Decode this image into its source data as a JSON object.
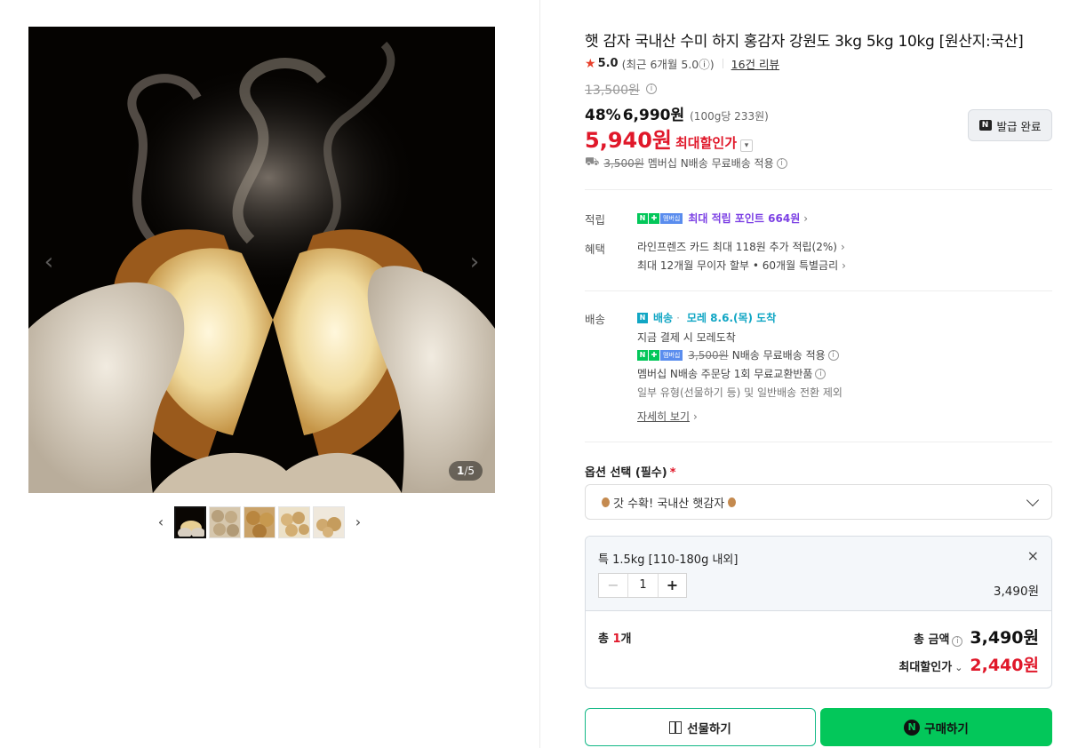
{
  "gallery": {
    "counter_current": "1",
    "counter_sep": "/",
    "counter_total": "5",
    "prev_arrow": "‹",
    "next_arrow": "›",
    "thumb_prev": "‹",
    "thumb_next": "›",
    "thumbnail_count": 5
  },
  "product": {
    "title": "햇 감자 국내산 수미 하지 홍감자 강원도 3kg 5kg 10kg [원산지:국산]",
    "star": "★",
    "rating": "5.0",
    "rating_note": "(최근 6개월 5.0ⓘ)",
    "reviews": "16건 리뷰",
    "original_price": "13,500원",
    "discount": "48%",
    "sale_price": "6,990원",
    "unit_price": "(100g당 233원)",
    "max_discount_price": "5,940원",
    "max_discount_label": "최대할인가",
    "coupon_button": "발급 완료",
    "coupon_badge": "N",
    "shipping_strike": "3,500원",
    "shipping_text": "멤버십 N배송 무료배송 적용"
  },
  "benefits": {
    "label_1": "적립",
    "label_2": "혜택",
    "point_text": "최대 적립 포인트 664원",
    "card_text": "라인프렌즈 카드 최대 118원 추가 적립(2%)",
    "installment_text": "최대 12개월 무이자 할부 • 60개월 특별금리",
    "membership_badge": "멤버십"
  },
  "delivery": {
    "label": "배송",
    "tag": "배송",
    "eta": "모레 8.6.(목) 도착",
    "line_1": "지금 결제 시 모레도착",
    "free_strike": "3,500원",
    "free_text": "N배송 무료배송 적용",
    "exchange_text": "멤버십 N배송 주문당 1회 무료교환반품",
    "exclusion_text": "일부 유형(선물하기 등) 및 일반배송 전환 제외",
    "more_link": "자세히 보기"
  },
  "options": {
    "title": "옵션 선택 (필수)",
    "required_mark": "*",
    "selected_value": "갓 수확! 국내산 햇감자",
    "item_name": "특 1.5kg [110-180g 내외]",
    "quantity": "1",
    "minus": "−",
    "plus": "+",
    "item_price": "3,490원",
    "close": "×"
  },
  "totals": {
    "label_prefix": "총 ",
    "count": "1",
    "label_suffix": "개",
    "amount_label": "총 금액",
    "amount": "3,490원",
    "max_label": "최대할인가",
    "max_amount": "2,440원"
  },
  "buttons": {
    "gift": "선물하기",
    "buy": "구매하기",
    "buy_badge": "N"
  },
  "colors": {
    "accent_red": "#e0182a",
    "naver_green": "#03c75a",
    "point_purple": "#7b3fe4",
    "delivery_cyan": "#11a6c4"
  }
}
